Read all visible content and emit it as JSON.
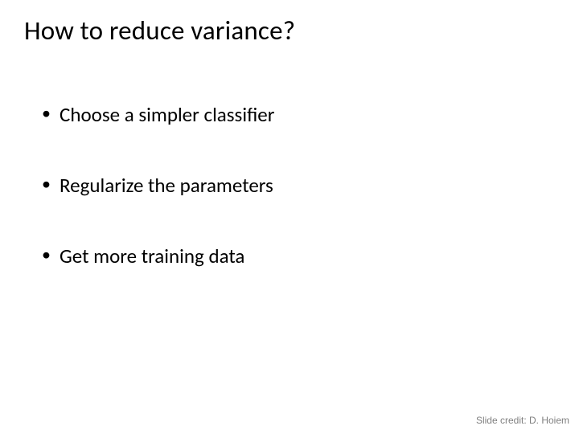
{
  "title": "How to reduce variance?",
  "bullets": [
    "Choose a simpler classifier",
    "Regularize the parameters",
    "Get more training data"
  ],
  "credit": "Slide credit: D. Hoiem"
}
